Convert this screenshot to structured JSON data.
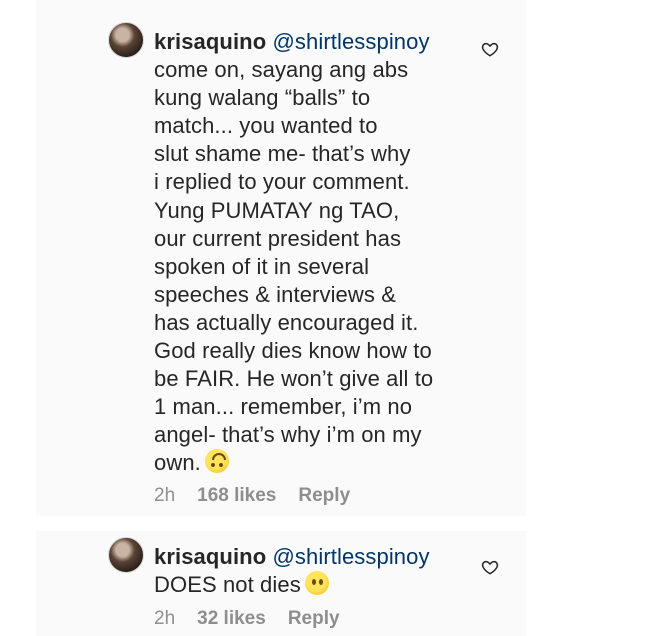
{
  "comments": [
    {
      "username": "krisaquino",
      "mention": "@shirtlesspinoy",
      "text": "come on, sayang ang abs\nkung walang “balls” to\nmatch... you wanted to\nslut shame me- that’s why\ni replied to your comment.\nYung PUMATAY ng TAO,\nour current president has\nspoken of it in several\nspeeches & interviews &\nhas actually encouraged it.\nGod really dies know how to\nbe FAIR. He won’t give all to\n1 man... remember, i’m no\nangel- that’s why i’m on my\nown.",
      "emoji": "upside-down-face",
      "time": "2h",
      "likes": "168 likes",
      "reply_label": "Reply"
    },
    {
      "username": "krisaquino",
      "mention": "@shirtlesspinoy",
      "text": "DOES not dies",
      "emoji": "face-without-mouth",
      "time": "2h",
      "likes": "32 likes",
      "reply_label": "Reply"
    }
  ],
  "icons": {
    "like": "heart-outline-icon"
  },
  "colors": {
    "mention": "#003569",
    "meta": "#8e8e8e",
    "text": "#262626"
  }
}
